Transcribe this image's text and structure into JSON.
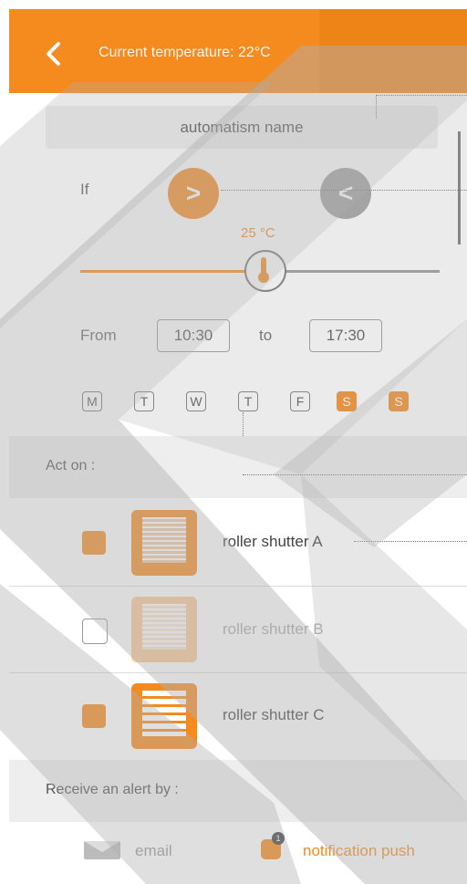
{
  "header": {
    "title": "Current temperature: 22°C",
    "back_icon": "chevron-left-icon",
    "color": "#f58a1f"
  },
  "automation": {
    "name": "automatism name",
    "condition_label": "If",
    "greater_button": ">",
    "less_button": "<",
    "selected_comparator": ">",
    "threshold": "25 °C",
    "threshold_fraction": 0.5
  },
  "schedule": {
    "from_label": "From",
    "from_value": "10:30",
    "to_label": "to",
    "to_value": "17:30",
    "days": [
      {
        "label": "M",
        "selected": false
      },
      {
        "label": "T",
        "selected": false
      },
      {
        "label": "W",
        "selected": false
      },
      {
        "label": "T",
        "selected": false
      },
      {
        "label": "F",
        "selected": false
      },
      {
        "label": "S",
        "selected": true
      },
      {
        "label": "S",
        "selected": true
      }
    ]
  },
  "act_on": {
    "heading": "Act on :",
    "devices": [
      {
        "label": "roller shutter A",
        "checked": true
      },
      {
        "label": "roller shutter B",
        "checked": false
      },
      {
        "label": "roller shutter C",
        "checked": true
      }
    ]
  },
  "alert": {
    "heading": "Receive an alert by :",
    "email_label": "email",
    "push_label": "notification push",
    "push_badge": "1"
  },
  "colors": {
    "accent": "#f58a1f",
    "section_bg": "#eeeeee",
    "inactive": "#a0a0a0"
  }
}
